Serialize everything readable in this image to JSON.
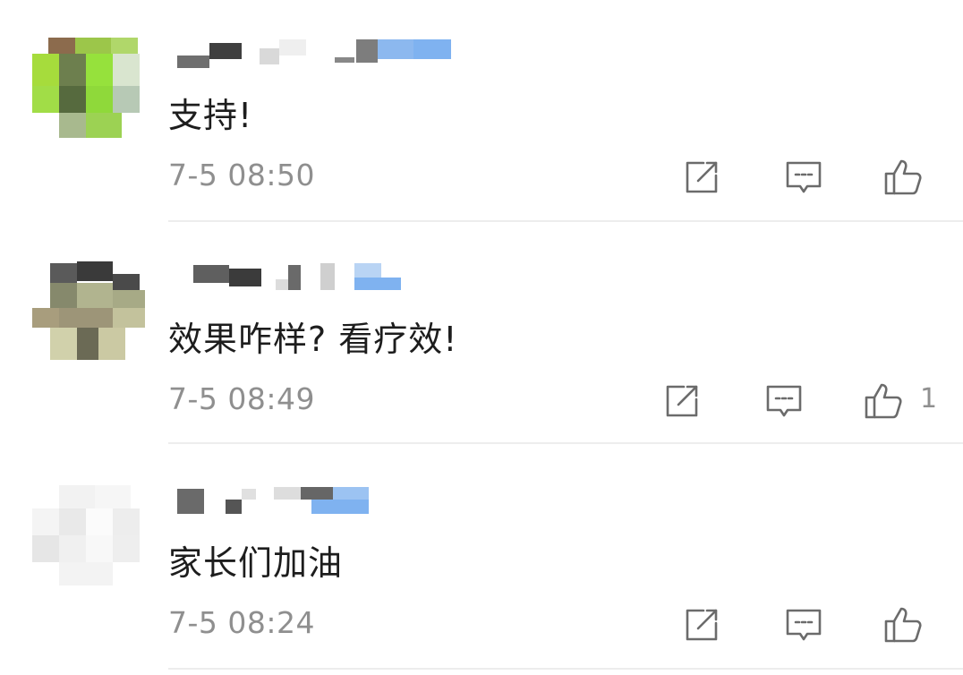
{
  "comments": [
    {
      "username": "(blurred username)",
      "text": "支持!",
      "time": "7-5 08:50",
      "likes": "",
      "icons": [
        "share-icon",
        "reply-icon",
        "thumbs-up-icon"
      ]
    },
    {
      "username": "(blurred username)",
      "text": "效果咋样? 看疗效!",
      "time": "7-5 08:49",
      "likes": "1",
      "icons": [
        "share-icon",
        "reply-icon",
        "thumbs-up-icon"
      ]
    },
    {
      "username": "(blurred username)",
      "text": "家长们加油",
      "time": "7-5 08:24",
      "likes": "",
      "icons": [
        "share-icon",
        "reply-icon",
        "thumbs-up-icon"
      ]
    }
  ],
  "colors": {
    "text": "#1d1d1d",
    "meta": "#8f8f8f",
    "icon": "#6b6b6b",
    "divider": "#ededed",
    "verified_badge": "#7fb2f0"
  }
}
